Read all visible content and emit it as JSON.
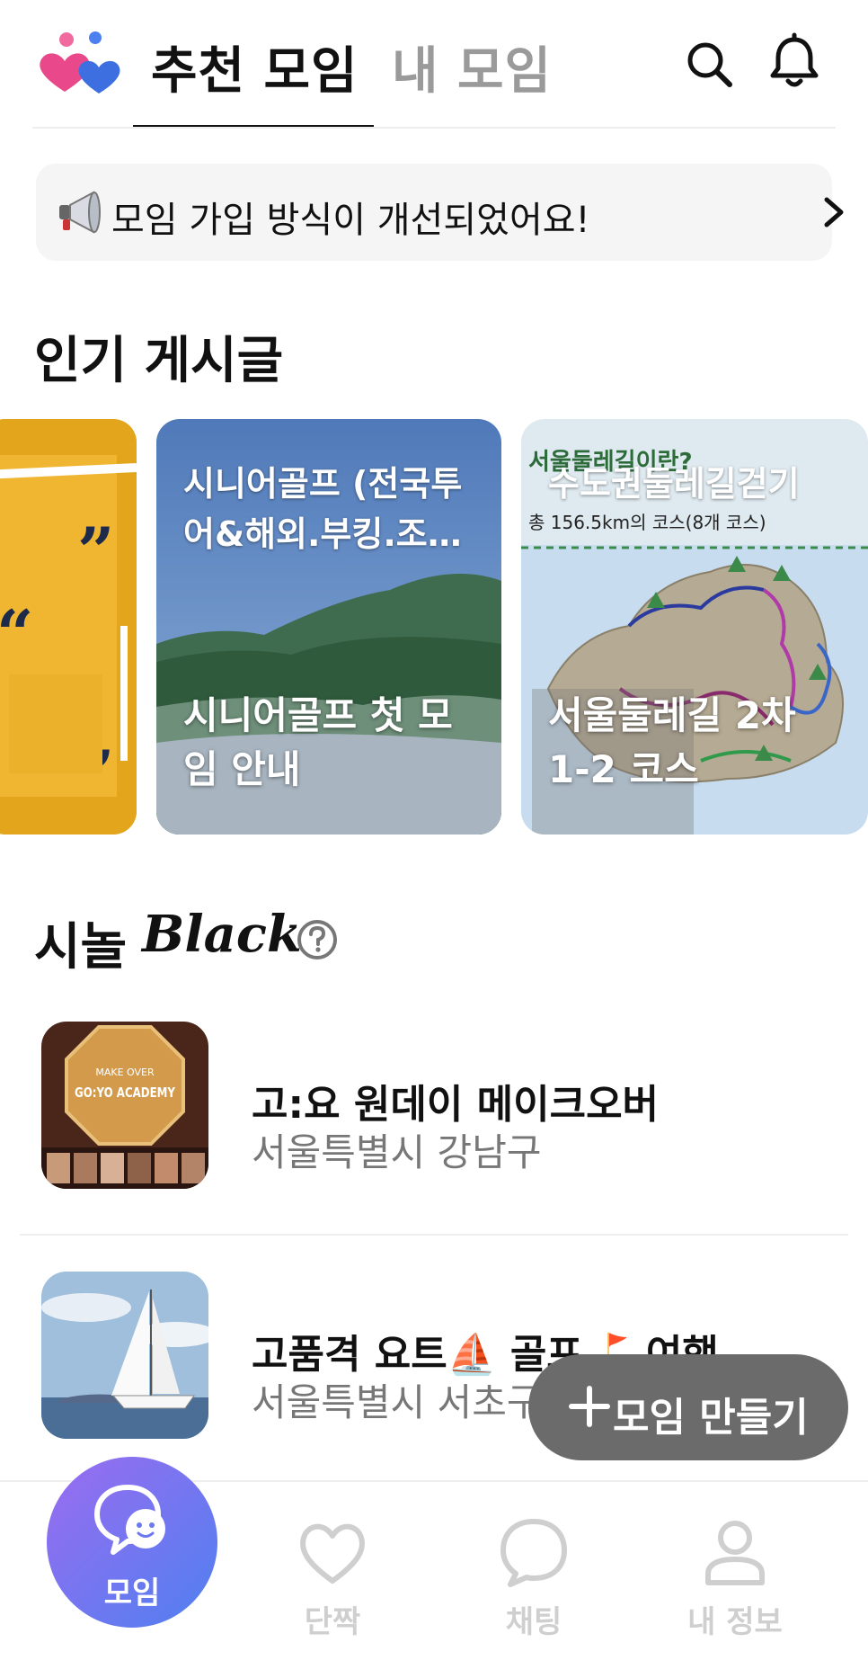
{
  "header": {
    "tabs": [
      {
        "label": "추천 모임",
        "active": true
      },
      {
        "label": "내 모임",
        "active": false
      }
    ]
  },
  "notice": {
    "text": "모임 가입 방식이 개선되었어요!"
  },
  "popular": {
    "title": "인기 게시글",
    "cards": [
      {
        "top_text": "",
        "bottom_text": ""
      },
      {
        "top_text": "시니어골프 (전국투어&해외.부킹.조…",
        "bottom_text": "시니어골프 첫 모임 안내"
      },
      {
        "top_text": "수도권둘레길걷기",
        "bottom_text": "서울둘레길 2차 1-2 코스"
      }
    ],
    "card_art": {
      "seoul_heading": "서울둘레길이란?",
      "seoul_sub": "총 156.5km의 코스(8개 코스)"
    }
  },
  "black": {
    "title": "시놀",
    "script": "Black",
    "items": [
      {
        "title": "고:요 원데이 메이크오버",
        "location": "서울특별시 강남구",
        "thumb_text": "GO:YO ACADEMY",
        "thumb_small": "MAKE OVER"
      },
      {
        "title": "고품격 요트⛵ 골프⛳ 여행",
        "location": "서울특별시 서초구"
      }
    ]
  },
  "fab": {
    "label": "모임 만들기"
  },
  "bottom_nav": [
    {
      "label": "모임",
      "icon": "moim-chat-icon",
      "active": true
    },
    {
      "label": "단짝",
      "icon": "heart-icon",
      "active": false
    },
    {
      "label": "채팅",
      "icon": "chat-bubble-icon",
      "active": false
    },
    {
      "label": "내 정보",
      "icon": "person-icon",
      "active": false
    }
  ],
  "colors": {
    "accent_gradient_start": "#9b6cf1",
    "accent_gradient_end": "#4f80ef",
    "inactive_nav": "#cfcfcf",
    "fab_bg": "#6b6b6b"
  }
}
